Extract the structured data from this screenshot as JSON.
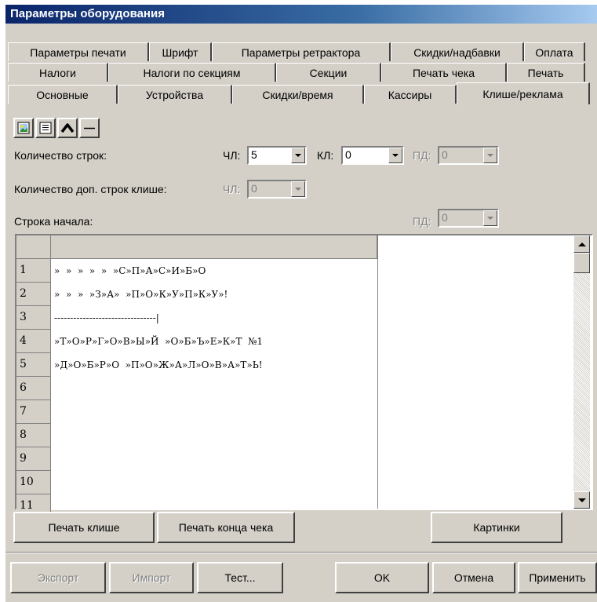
{
  "window": {
    "title": "Параметры оборудования"
  },
  "tabs": {
    "row1": [
      "Параметры печати",
      "Шрифт",
      "Параметры ретрактора",
      "Скидки/надбавки",
      "Оплата"
    ],
    "row2": [
      "Налоги",
      "Налоги по секциям",
      "Секции",
      "Печать чека",
      "Печать"
    ],
    "row3": [
      "Основные",
      "Устройства",
      "Скидки/время",
      "Кассиры",
      "Клише/реклама"
    ],
    "active": "Клише/реклама"
  },
  "toolbar": {
    "buttons": [
      {
        "icon": "picture-icon"
      },
      {
        "icon": "text-align-icon"
      },
      {
        "icon": "arc-icon"
      },
      {
        "icon": "line-icon"
      }
    ]
  },
  "settings": {
    "line_count_label": "Количество строк:",
    "chl_label": "ЧЛ:",
    "chl_value": "5",
    "kl_label": "КЛ:",
    "kl_value": "0",
    "pd_label": "ПД:",
    "pd_value": "0",
    "extra_lines_label": "Количество доп. строк клише:",
    "extra_chl_label": "ЧЛ:",
    "extra_chl_value": "0",
    "start_line_label": "Строка начала:",
    "start_pd_label": "ПД:",
    "start_pd_value": "0"
  },
  "grid": {
    "rows": [
      {
        "num": "1",
        "text": "»  »  »  »  »  »С»П»А»С»И»Б»О"
      },
      {
        "num": "2",
        "text": "»  »  »  »З»А»  »П»О»К»У»П»К»У»!"
      },
      {
        "num": "3",
        "text": "--------------------------------|"
      },
      {
        "num": "4",
        "text": "»Т»О»Р»Г»О»В»Ы»Й  »О»Б»Ъ»Е»К»Т  №1"
      },
      {
        "num": "5",
        "text": "»Д»О»Б»Р»О  »П»О»Ж»А»Л»О»В»А»Т»Ь!"
      },
      {
        "num": "6",
        "text": ""
      },
      {
        "num": "7",
        "text": ""
      },
      {
        "num": "8",
        "text": ""
      },
      {
        "num": "9",
        "text": ""
      },
      {
        "num": "10",
        "text": ""
      },
      {
        "num": "11",
        "text": ""
      }
    ]
  },
  "actions": {
    "print_cliche": "Печать клише",
    "print_receipt_end": "Печать конца чека",
    "pictures": "Картинки"
  },
  "footer": {
    "export": "Экспорт",
    "import": "Импорт",
    "test": "Тест...",
    "ok": "OK",
    "cancel": "Отмена",
    "apply": "Применить"
  },
  "colors": {
    "title_bar": "#0a246a",
    "face": "#d4d0c8"
  }
}
